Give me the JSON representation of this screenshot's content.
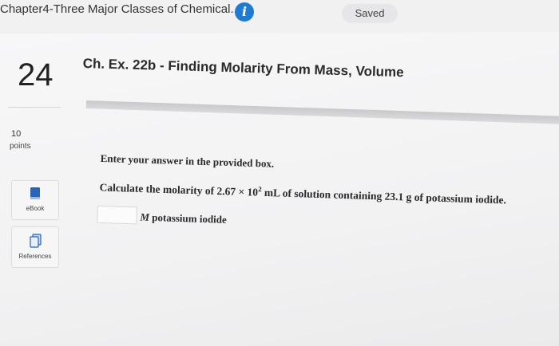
{
  "header": {
    "assignment_title": "Chapter4-Three Major Classes of Chemical...",
    "info_icon": "info-icon",
    "saved_label": "Saved"
  },
  "question": {
    "number": "24",
    "points_value": "10",
    "points_label": "points",
    "title": "Ch. Ex. 22b - Finding Molarity From Mass, Volume",
    "instruction": "Enter your answer in the provided box.",
    "prompt_before": "Calculate the molarity of 2.67 × 10",
    "prompt_exponent": "2",
    "prompt_after": " mL of solution containing 23.1 g of potassium iodide.",
    "answer_value": "",
    "unit_symbol": "M",
    "unit_text": " potassium iodide"
  },
  "tools": [
    {
      "label": "eBook",
      "icon": "ebook-icon"
    },
    {
      "label": "References",
      "icon": "references-icon"
    }
  ],
  "colors": {
    "info_blue": "#1f7bd1",
    "ebook_blue": "#2b63b5"
  }
}
